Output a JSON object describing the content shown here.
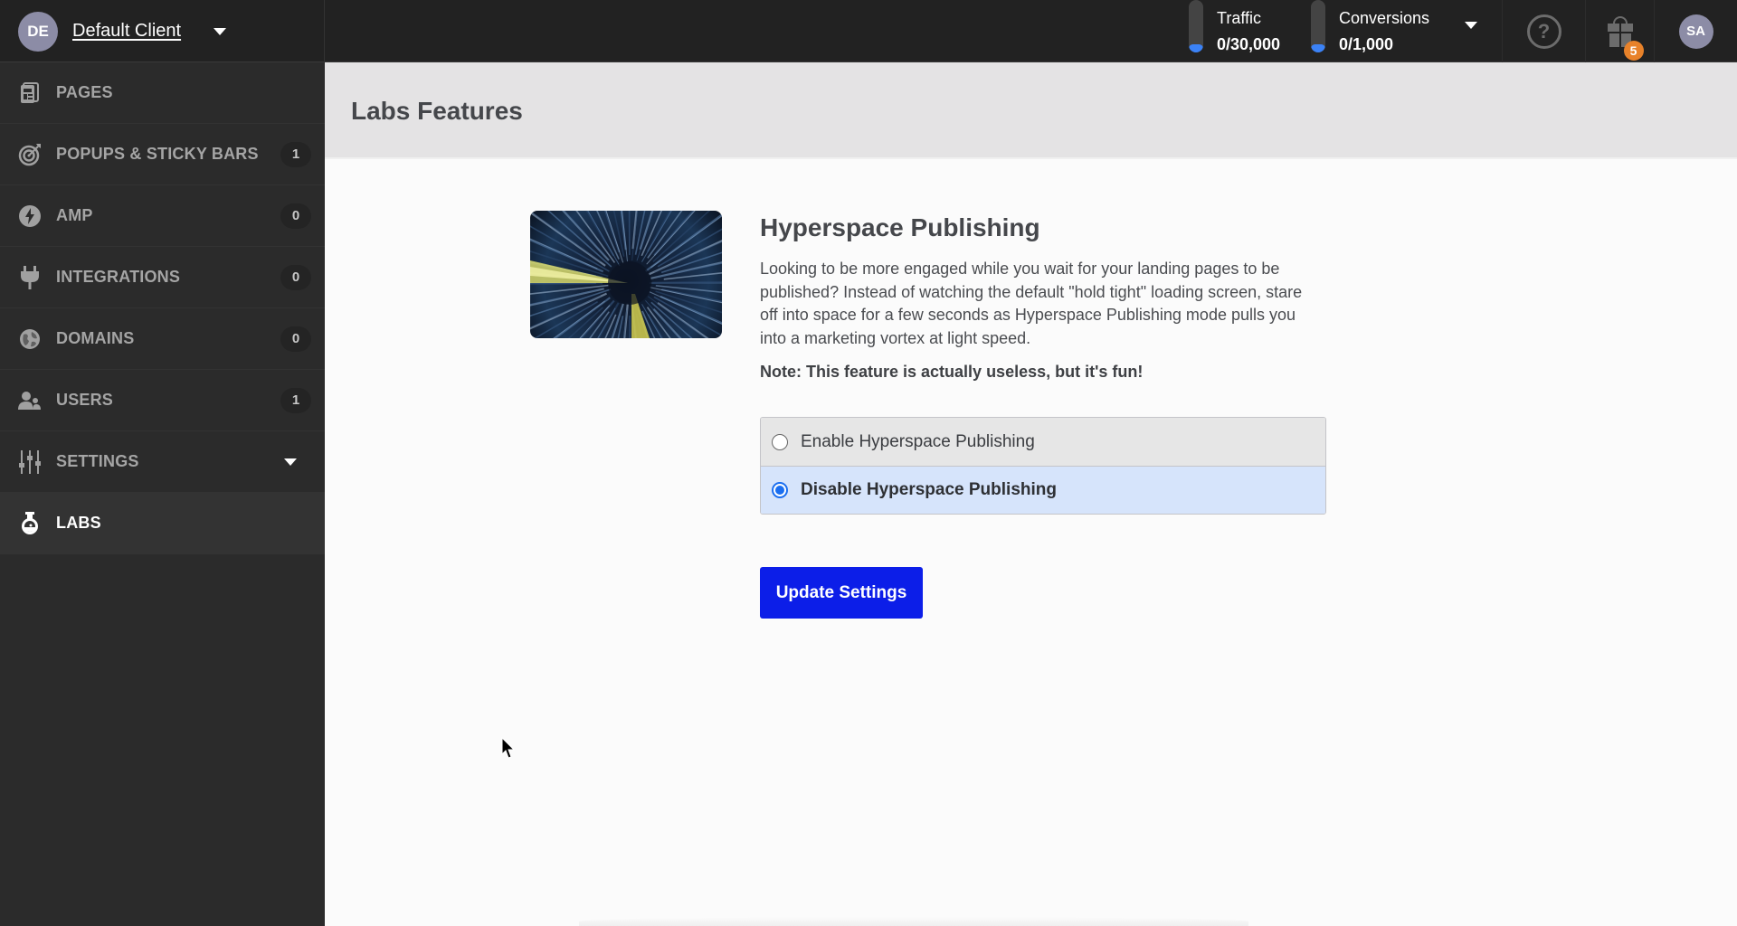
{
  "header": {
    "client": {
      "initials": "DE",
      "name": "Default Client"
    },
    "meters": [
      {
        "label": "Traffic",
        "value": "0/30,000",
        "fill": 0.0
      },
      {
        "label": "Conversions",
        "value": "0/1,000",
        "fill": 0.0
      }
    ],
    "notifications_count": "5",
    "help_icon_glyph": "?",
    "user_initials": "SA"
  },
  "sidebar": {
    "items": [
      {
        "label": "PAGES",
        "icon": "pages-icon",
        "count": null
      },
      {
        "label": "POPUPS & STICKY BARS",
        "icon": "target-icon",
        "count": "1"
      },
      {
        "label": "AMP",
        "icon": "lightning-icon",
        "count": "0"
      },
      {
        "label": "INTEGRATIONS",
        "icon": "plug-icon",
        "count": "0"
      },
      {
        "label": "DOMAINS",
        "icon": "globe-icon",
        "count": "0"
      },
      {
        "label": "USERS",
        "icon": "users-icon",
        "count": "1"
      },
      {
        "label": "SETTINGS",
        "icon": "sliders-icon",
        "count": null,
        "expandable": true
      },
      {
        "label": "LABS",
        "icon": "flask-icon",
        "count": null,
        "active": true
      }
    ]
  },
  "main": {
    "page_title": "Labs Features",
    "feature": {
      "title": "Hyperspace Publishing",
      "description": "Looking to be more engaged while you wait for your landing pages to be published? Instead of watching the default \"hold tight\" loading screen, stare off into space for a few seconds as Hyperspace Publishing mode pulls you into a marketing vortex at light speed.",
      "note": "Note: This feature is actually useless, but it's fun!",
      "options": [
        {
          "label": "Enable Hyperspace Publishing",
          "selected": false
        },
        {
          "label": "Disable Hyperspace Publishing",
          "selected": true
        }
      ],
      "submit_label": "Update Settings"
    }
  },
  "colors": {
    "header_bg": "#222222",
    "sidebar_bg": "#2b2b2b",
    "accent_button": "#0c1ee8",
    "selected_option_bg": "#d6e4fb",
    "badge_orange": "#e8822a",
    "meter_fill": "#3b82f6"
  }
}
